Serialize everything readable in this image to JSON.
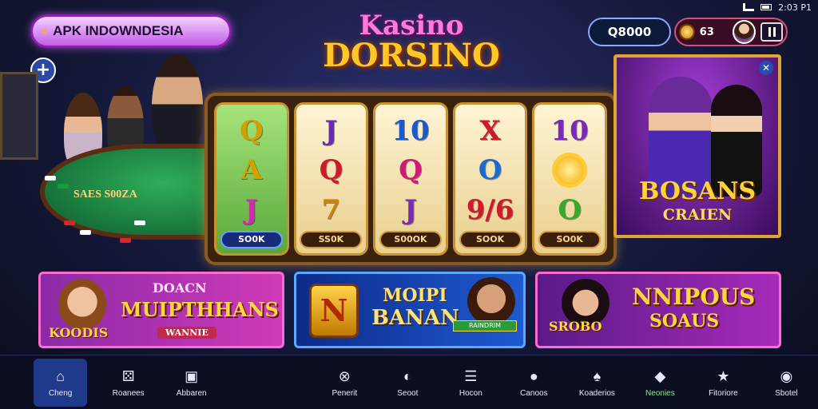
{
  "status": {
    "time": "2:03 P1"
  },
  "back_pill": {
    "label": "APK INDOWNDESIA"
  },
  "title": {
    "line1": "Kasino",
    "line2": "DORSINO"
  },
  "wallet": {
    "coins": "Q8000",
    "gems": "63"
  },
  "table": {
    "label": "SAES S00ZA"
  },
  "slot": {
    "reels": [
      {
        "symbols": [
          "Q",
          "A",
          "J"
        ],
        "colors": [
          "#d4a000",
          "#d4a000",
          "#d02ab0"
        ],
        "value": "SO0K"
      },
      {
        "symbols": [
          "J",
          "Q",
          "7"
        ],
        "colors": [
          "#6a2ab8",
          "#d01a2a",
          "#d48000"
        ],
        "value": "SS0K"
      },
      {
        "symbols": [
          "10",
          "Q",
          "J"
        ],
        "colors": [
          "#1a5ad0",
          "#d01a7a",
          "#7a2ab8"
        ],
        "value": "S00OK"
      },
      {
        "symbols": [
          "X",
          "O",
          "9/6"
        ],
        "colors": [
          "#d01a2a",
          "#1a6ad0",
          "#d01a2a"
        ],
        "value": "SOOK"
      },
      {
        "symbols": [
          "10",
          "sun",
          "O"
        ],
        "colors": [
          "#7a2ab8",
          "#f2a800",
          "#3aa82a"
        ],
        "value": "SO0K"
      }
    ]
  },
  "promo": {
    "line1": "BOSANS",
    "line2": "CRAIEN"
  },
  "banners": [
    {
      "line1": "DOACN",
      "line2": "MUIPTHHANS",
      "line3": "KOODIS",
      "tag": "WANNIE"
    },
    {
      "tile": "N",
      "line1": "MOIPI",
      "line2": "BANAN",
      "ribbon": "RAINDRIM"
    },
    {
      "line1": "NNIPOUS",
      "line2": "SOAUS",
      "line3": "SROBO"
    }
  ],
  "nav": [
    {
      "label": "Cheng",
      "icon": "home-icon"
    },
    {
      "label": "Roanees",
      "icon": "dice-icon"
    },
    {
      "label": "Abbaren",
      "icon": "bag-icon"
    },
    {
      "label": "Penerit",
      "icon": "compass-icon"
    },
    {
      "label": "Seoot",
      "icon": "globe-icon"
    },
    {
      "label": "Hocon",
      "icon": "list-icon"
    },
    {
      "label": "Canoos",
      "icon": "ball-icon"
    },
    {
      "label": "Koaderios",
      "icon": "cards-icon"
    },
    {
      "label": "Neonies",
      "icon": "gift-icon"
    },
    {
      "label": "Fitoriore",
      "icon": "star-icon"
    },
    {
      "label": "Sbotel",
      "icon": "shop-icon"
    }
  ],
  "colors": {
    "accent": "#ffc727",
    "nav_active": "#1f3a8a",
    "nav_green": "#7cf07c"
  }
}
